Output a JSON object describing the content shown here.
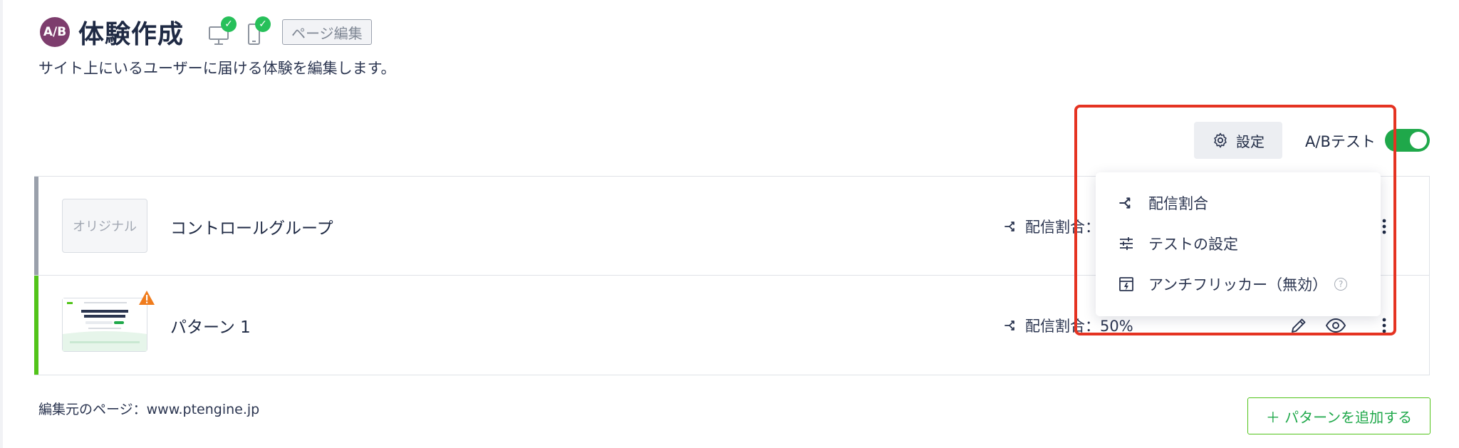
{
  "header": {
    "badge": "A/B",
    "title": "体験作成",
    "edit_tag": "ページ編集",
    "subtitle": "サイト上にいるユーザーに届ける体験を編集します。"
  },
  "toolbar": {
    "settings_label": "設定",
    "abtest_label": "A/Bテスト",
    "abtest_enabled": true
  },
  "variants": [
    {
      "thumb_label": "オリジナル",
      "name": "コントロールグループ",
      "traffic": "配信割合："
    },
    {
      "name": "パターン 1",
      "traffic": "配信割合：50%"
    }
  ],
  "dropdown": {
    "items": [
      {
        "label": "配信割合",
        "icon": "split-icon"
      },
      {
        "label": "テストの設定",
        "icon": "sliders-icon"
      },
      {
        "label": "アンチフリッカー（無効）",
        "icon": "anti-flicker-icon"
      }
    ],
    "help_glyph": "?"
  },
  "footer": {
    "source_page": "編集元のページ：www.ptengine.jp",
    "add_pattern": "＋ パターンを追加する"
  },
  "colors": {
    "accent_green": "#1fa84a",
    "badge": "#7d3d6d",
    "highlight": "#e53322",
    "original_bar": "#9aa0ab",
    "variant_bar": "#52c41a"
  }
}
